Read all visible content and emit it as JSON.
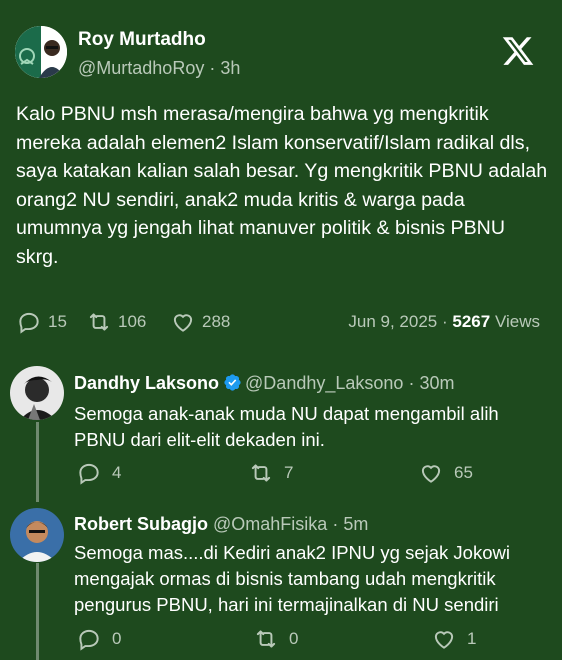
{
  "post": {
    "author_name": "Roy Murtadho",
    "author_handle": "@MurtadhoRoy",
    "separator": "·",
    "time": "3h",
    "platform_icon": "x-logo-icon",
    "text": "Kalo PBNU msh merasa/mengira bahwa yg mengkritik mereka adalah elemen2 Islam konservatif/Islam radikal dls, saya katakan kalian salah besar. Yg mengkritik PBNU adalah orang2 NU sendiri, anak2 muda kritis & warga pada umumnya yg jengah lihat manuver politik & bisnis PBNU skrg.",
    "replies_count": "15",
    "reposts_count": "106",
    "likes_count": "288",
    "date": "Jun 9, 2025",
    "date_sep": "·",
    "views_count": "5267",
    "views_label": "Views"
  },
  "replies": [
    {
      "name": "Dandhy Laksono",
      "verified": true,
      "handle": "@Dandhy_Laksono",
      "separator": "·",
      "time": "30m",
      "text": "Semoga anak-anak muda NU dapat mengambil alih PBNU dari elit-elit dekaden ini.",
      "replies_count": "4",
      "reposts_count": "7",
      "likes_count": "65"
    },
    {
      "name": "Robert Subagjo",
      "verified": false,
      "handle": "@OmahFisika",
      "separator": "·",
      "time": "5m",
      "text": "Semoga mas....di Kediri anak2 IPNU yg sejak Jokowi mengajak ormas di bisnis tambang udah mengkritik pengurus PBNU, hari ini termajinalkan di NU sendiri",
      "replies_count": "0",
      "reposts_count": "0",
      "likes_count": "1"
    }
  ],
  "colors": {
    "background": "#1e4a1e",
    "text": "#ffffff",
    "muted": "#b9c9b9",
    "verified": "#1d9bf0",
    "thread_line": "#6f8a6f"
  }
}
